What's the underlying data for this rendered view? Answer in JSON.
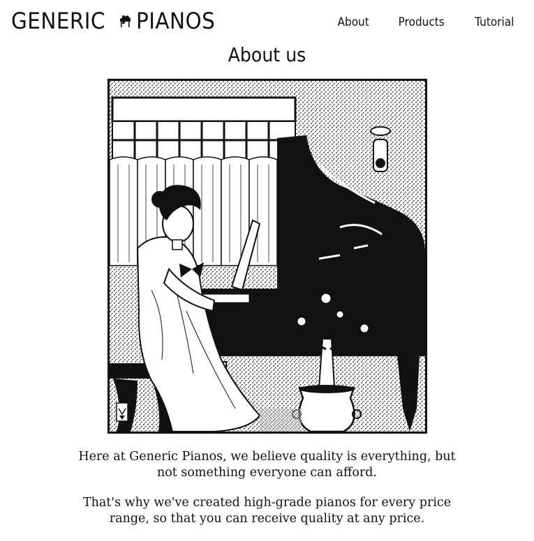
{
  "brand": {
    "name_left": "GENERIC",
    "name_right": "PIANOS",
    "icon": "piano-icon"
  },
  "nav": {
    "items": [
      {
        "label": "About"
      },
      {
        "label": "Products"
      },
      {
        "label": "Tutorial"
      }
    ]
  },
  "main": {
    "title": "About us",
    "illustration": {
      "icon": "woman-playing-grand-piano-illustration"
    },
    "paragraphs": [
      "Here at Generic Pianos, we believe quality is everything, but not something everyone can afford.",
      "That's why we've created high-grade pianos for every price range, so that you can receive quality at any price."
    ]
  },
  "colors": {
    "text": "#111111",
    "background": "#ffffff"
  }
}
